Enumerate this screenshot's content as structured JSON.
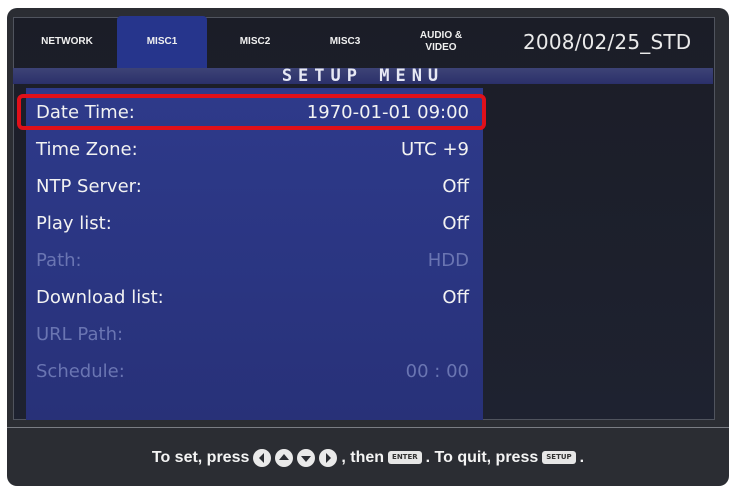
{
  "tabs": [
    {
      "label": "NETWORK"
    },
    {
      "label": "MISC1"
    },
    {
      "label": "MISC2"
    },
    {
      "label": "MISC3"
    },
    {
      "label": "AUDIO &\nVIDEO"
    }
  ],
  "active_tab": "MISC1",
  "firmware_version": "2008/02/25_STD",
  "title": "SETUP MENU",
  "menu": {
    "items": [
      {
        "label": "Date Time:",
        "value": "1970-01-01 09:00",
        "state": "selected"
      },
      {
        "label": "Time Zone:",
        "value": "UTC +9",
        "state": "enabled"
      },
      {
        "label": "NTP Server:",
        "value": "Off",
        "state": "enabled"
      },
      {
        "label": "Play list:",
        "value": "Off",
        "state": "enabled"
      },
      {
        "label": "Path:",
        "value": "HDD",
        "state": "disabled"
      },
      {
        "label": "Download list:",
        "value": "Off",
        "state": "enabled"
      },
      {
        "label": "URL Path:",
        "value": "",
        "state": "disabled"
      },
      {
        "label": "Schedule:",
        "value": "00 : 00",
        "state": "disabled"
      }
    ]
  },
  "footer": {
    "prefix": "To set, press",
    "middle": ", then",
    "enter_key": "ENTER",
    "suffix1": ". To quit, press",
    "setup_key": "SETUP",
    "suffix2": "."
  },
  "icons": [
    "arrow-left-icon",
    "arrow-up-icon",
    "arrow-down-icon",
    "arrow-right-icon"
  ],
  "colors": {
    "panel": "#2a3581",
    "active_tab": "#26358c",
    "highlight": "#e0101a",
    "disabled_text": "#6a75b2"
  }
}
